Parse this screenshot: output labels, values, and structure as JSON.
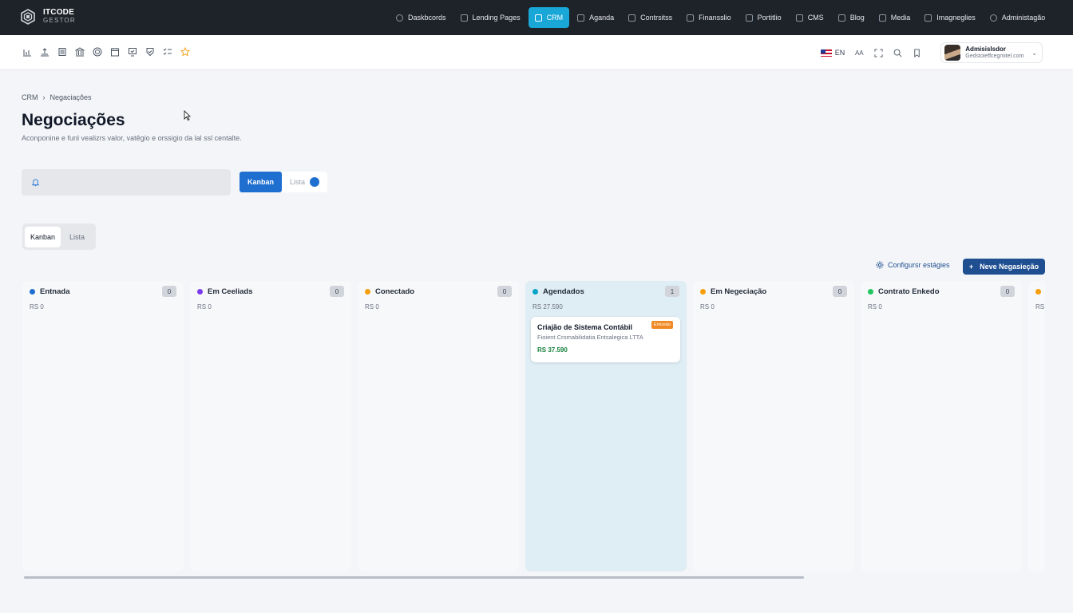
{
  "brand": {
    "line1": "ITCODE",
    "line2": "GESTOR"
  },
  "nav": [
    {
      "label": "Daskbcords",
      "active": false
    },
    {
      "label": "Lending Pages",
      "active": false
    },
    {
      "label": "CRM",
      "active": true
    },
    {
      "label": "Aganda",
      "active": false
    },
    {
      "label": "Contrsitss",
      "active": false
    },
    {
      "label": "Finansslio",
      "active": false
    },
    {
      "label": "Portitlio",
      "active": false
    },
    {
      "label": "CMS",
      "active": false
    },
    {
      "label": "Blog",
      "active": false
    },
    {
      "label": "Media",
      "active": false
    },
    {
      "label": "Imagneglies",
      "active": false
    },
    {
      "label": "Administagão",
      "active": false
    }
  ],
  "toolbar": {
    "icons": [
      "chart-icon",
      "upload-icon",
      "list-icon",
      "bank-icon",
      "target-icon",
      "calendar-icon",
      "check-card-icon",
      "shield-check-icon",
      "tasks-icon",
      "star-icon"
    ],
    "lang": "EN",
    "font_size": "AA",
    "user": {
      "name": "Admisislsdor",
      "email": "Gedstoieffcegmitel.com"
    }
  },
  "breadcrumb": {
    "root": "CRM",
    "sep": "›",
    "current": "Negaciações"
  },
  "page": {
    "title": "Negociações",
    "subtitle": "Aconponine e funl vealizrs valor, vatêgio e orssigio da lal ssl centalte."
  },
  "search": {
    "placeholder": ""
  },
  "view_toggle": {
    "kanban": "Kanban",
    "lista": "Lista"
  },
  "tabs": {
    "kanban": "Kanban",
    "lista": "Lista"
  },
  "actions": {
    "config": "Configursr estágies",
    "new": "Neve Negasieção",
    "new_plus": "+"
  },
  "colors": {
    "accent": "#1f6fd1",
    "brand_dark": "#1f4f91",
    "nav_active": "#19a7d8"
  },
  "columns": [
    {
      "title": "Entnada",
      "count": "0",
      "total": "RS 0",
      "dot": "#1f6fd1"
    },
    {
      "title": "Em Ceeliads",
      "count": "0",
      "total": "RS 0",
      "dot": "#7c3aed"
    },
    {
      "title": "Conectado",
      "count": "0",
      "total": "RS 0",
      "dot": "#f59e0b"
    },
    {
      "title": "Agendados",
      "count": "1",
      "total": "RS 27.590",
      "dot": "#06a3c9",
      "highlight": true,
      "card": {
        "title": "Criajão de Sistema Contábil",
        "company": "Fioient Cromabilidatia Entsalegica LTTA",
        "value": "RS 37.590",
        "badge": "Emissão"
      }
    },
    {
      "title": "Em Negeciação",
      "count": "0",
      "total": "RS 0",
      "dot": "#f59e0b"
    },
    {
      "title": "Contrato Enkedo",
      "count": "0",
      "total": "RS 0",
      "dot": "#22c55e"
    },
    {
      "title": "",
      "count": "",
      "total": "RS",
      "dot": "#f59e0b"
    }
  ]
}
